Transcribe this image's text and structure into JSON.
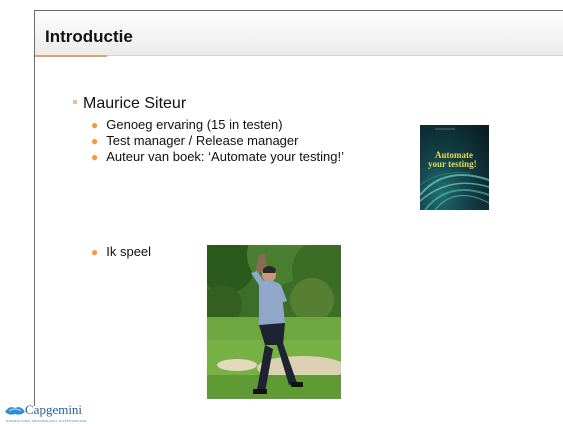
{
  "slide": {
    "title": "Introductie",
    "level1": {
      "text": "Maurice Siteur"
    },
    "bullets": [
      "Genoeg ervaring (15 in testen)",
      "Test manager / Release manager",
      "Auteur van boek: ‘Automate your testing!’"
    ],
    "bullet_golf": "Ik speel",
    "book_cover": {
      "title_line1": "Automate",
      "title_line2": "your testing!"
    },
    "photo": "golf-player-photo"
  },
  "footer": {
    "logo_text": "Capgemini",
    "tagline": "CONSULTING.TECHNOLOGY.OUTSOURCING"
  },
  "colors": {
    "title_accent": "#d8a472",
    "bullet": "#f29a40",
    "logo_blue": "#1f5e9e"
  }
}
